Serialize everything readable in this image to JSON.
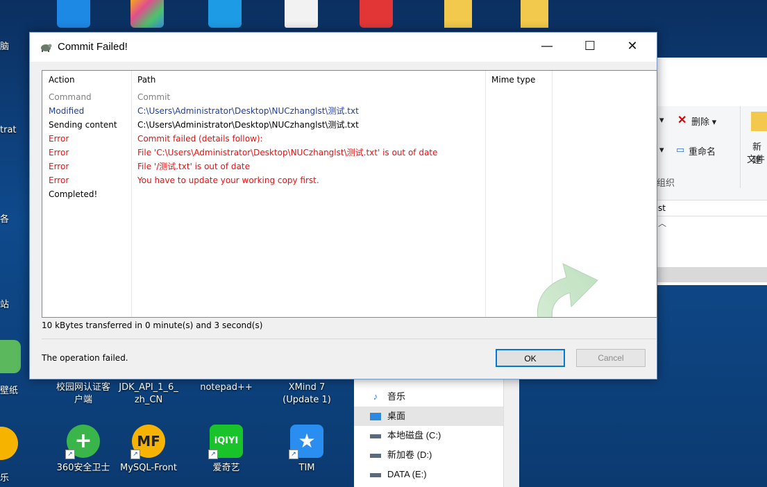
{
  "dialog": {
    "title": "Commit Failed!",
    "columns": {
      "action": "Action",
      "path": "Path",
      "mime": "Mime type"
    },
    "rows": [
      {
        "action": "Command",
        "path": "Commit",
        "color": "#808080"
      },
      {
        "action": "Modified",
        "path": "C:\\Users\\Administrator\\Desktop\\NUCzhanglst\\测试.txt",
        "color": "#1f3fa6"
      },
      {
        "action": "Sending content",
        "path": "C:\\Users\\Administrator\\Desktop\\NUCzhanglst\\测试.txt",
        "color": "#000000"
      },
      {
        "action": "Error",
        "path": "Commit failed (details follow):",
        "color": "#e81010"
      },
      {
        "action": "Error",
        "path": "File 'C:\\Users\\Administrator\\Desktop\\NUCzhanglst\\测试.txt' is out of date",
        "color": "#e81010"
      },
      {
        "action": "Error",
        "path": "File '/测试.txt' is out of date",
        "color": "#e81010"
      },
      {
        "action": "Error",
        "path": "You have to update your working copy first.",
        "color": "#e81010"
      },
      {
        "action": "Completed!",
        "path": "",
        "color": "#000000"
      }
    ],
    "transfer_text": "10 kBytes transferred in 0 minute(s) and 3 second(s)",
    "status_text": "The operation failed.",
    "ok_label": "OK",
    "cancel_label": "Cancel",
    "window_controls": {
      "minimize": "—",
      "maximize": "☐",
      "close": "✕"
    }
  },
  "desktop": {
    "icons_row1": [
      {
        "label": "校园网认证客\n户端",
        "color": "#2a7ad0"
      },
      {
        "label": "JDK_API_1_6_\nzh_CN",
        "color": "#3a9a3a"
      },
      {
        "label": "notepad++",
        "color": "#2a6acb"
      },
      {
        "label": "XMind 7\n(Update 1)",
        "color": "#e0e0e0"
      }
    ],
    "icons_row2": [
      {
        "label": "360安全卫士",
        "color": "#39b54a",
        "glyph": "+"
      },
      {
        "label": "MySQL-Front",
        "color": "#f6b400",
        "glyph": "MF"
      },
      {
        "label": "爱奇艺",
        "color": "#19c32a",
        "glyph": "iQIYI"
      },
      {
        "label": "TIM",
        "color": "#2a8df0",
        "glyph": "★"
      }
    ],
    "left_labels": [
      "脑",
      "trat",
      "各",
      "站",
      "壁纸",
      "乐"
    ]
  },
  "explorer": {
    "delete_label": "删除",
    "rename_label": "重命名",
    "new_label": "新建",
    "file_label": "文件",
    "organize_label": "组织",
    "address_fragment": "st",
    "nav_items": [
      {
        "label": "音乐",
        "icon": "music-icon"
      },
      {
        "label": "桌面",
        "icon": "desktop-icon",
        "selected": true
      },
      {
        "label": "本地磁盘 (C:)",
        "icon": "drive-icon"
      },
      {
        "label": "新加卷 (D:)",
        "icon": "drive-icon"
      },
      {
        "label": "DATA (E:)",
        "icon": "drive-icon"
      }
    ]
  }
}
